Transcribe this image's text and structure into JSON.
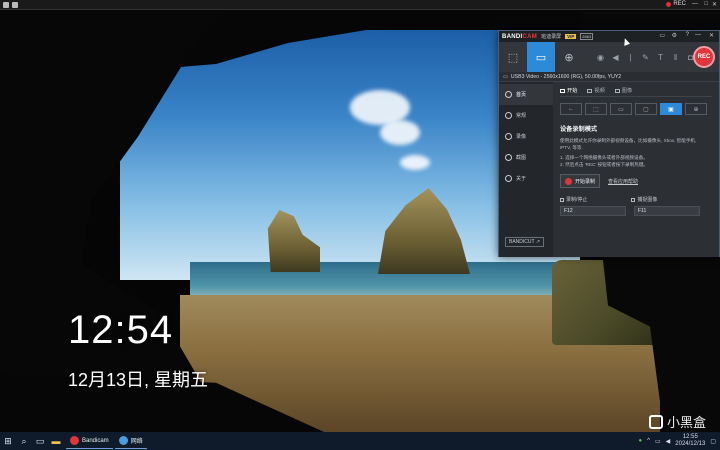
{
  "topbar": {
    "rec_label": "REC",
    "controls": [
      "—",
      "□",
      "✕"
    ]
  },
  "desktop": {
    "time": "12:54",
    "date": "12月13日, 星期五"
  },
  "bandicam": {
    "brand_main": "BANDI",
    "brand_accent": "CAM",
    "subtitle": "班迪录屏",
    "vip": "VIP",
    "version_tag": "6963",
    "title_controls": [
      "▭",
      "⚙",
      "?",
      "—",
      "✕"
    ],
    "rec_button": "REC",
    "device_info": "USB3 Video - 2560x1600 (RG), 50.00fps, YUY2",
    "sidebar": [
      {
        "label": "首页",
        "active": true
      },
      {
        "label": "常规",
        "active": false
      },
      {
        "label": "录像",
        "active": false
      },
      {
        "label": "截图",
        "active": false
      },
      {
        "label": "关于",
        "active": false
      }
    ],
    "bandicut": "BANDICUT ↗",
    "tabs": [
      {
        "label": "开始",
        "active": true
      },
      {
        "label": "视频",
        "active": false
      },
      {
        "label": "图像",
        "active": false
      }
    ],
    "heading": "设备录制模式",
    "description": "使用此模式允许你录制外部视频设备，比如摄像头, Xbox, 智能手机, IPTV, 等等.",
    "steps": [
      "1. 选择一个网络摄像头或者外部视频设备。",
      "2. 然后点击 'REC' 按钮或者按下录制热键。"
    ],
    "start_button": "开始录制",
    "help_link": "查看应用帮助",
    "hotkey_record_label": "录制/停止",
    "hotkey_capture_label": "捕捉图像",
    "hotkey_record": "F12",
    "hotkey_capture": "F11"
  },
  "taskbar": {
    "app1": "Bandicam",
    "app2": "网络",
    "clock_time": "12:55",
    "clock_date": "2024/12/13",
    "watermark": "小黑盒"
  },
  "colors": {
    "accent": "#2d8ad8",
    "rec": "#e0353b",
    "taskbar": "#0f1b2a"
  }
}
